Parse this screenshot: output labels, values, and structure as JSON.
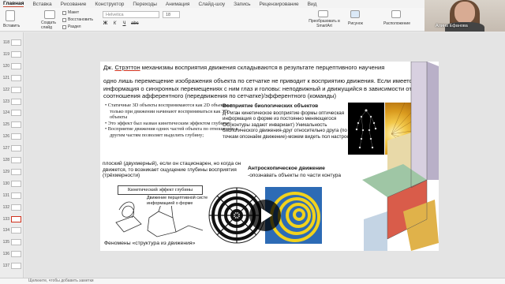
{
  "ribbon": {
    "tabs": [
      "Главная",
      "Вставка",
      "Рисование",
      "Конструктор",
      "Переходы",
      "Анимация",
      "Слайд-шоу",
      "Запись",
      "Рецензирование",
      "Вид"
    ],
    "active_tab": "Главная",
    "paste_label": "Вставить",
    "new_slide_label": "Создать слайд",
    "layout_label": "Макет",
    "reset_label": "Восстановить",
    "section_label": "Раздел",
    "font_placeholder": "Helvetica",
    "font_size": "18",
    "smartart_label": "Преобразовать в SmartArt",
    "picture_label": "Рисунок",
    "arrange_label": "Расположение"
  },
  "webcam": {
    "name": "Алина Ефанова"
  },
  "slide_panel": {
    "numbers": [
      "118",
      "119",
      "120",
      "121",
      "122",
      "123",
      "124",
      "125",
      "126",
      "127",
      "128",
      "129",
      "130",
      "131",
      "132",
      "133",
      "134",
      "135",
      "136",
      "137"
    ],
    "selected": "133"
  },
  "slide": {
    "title_pre": "Дж. ",
    "title_name": "Стрэттон",
    "title_post": " механизмы восприятия движения складываются в результате перцептивного научения",
    "intro": "одно лишь перемещение изображения объекта по сетчатке не приводит к восприятию движения. Если имеется информация о синхронных перемещениях с ним глаз и головы: неподвижный и движущийся в зависимости от соотношения афферентного (передвижения по сетчатке)/эфферентного (команды)",
    "bullets": [
      "Статичные 3D объекты воспринимаются как 2D объекты и только при движении начинают восприниматься как 3D объекты",
      "Это эффект был назван кинетическим эффектом глубины;",
      "Восприятие движения одних частей объекта по отношению к другим частям позволяет выделить глубину;"
    ],
    "flat_text": "плоский (двухмерный), если он стационарен, но когда он движется, то возникает ощущение глубины восприятия (трёхмерности)",
    "bio_heading": "Восприятие биологических объектов",
    "bio_text": "Д Риган кинетическое восприятие формы оптическая информация о форме из постоянно меняющегося ОС(контуры задают инвариант) Уникальность биологического движения-друг относительно друга (по 12 точкам опознаём движение)-можем видеть пол настроение",
    "antro_heading": "Антроскопическое движение",
    "antro_text": "-опознавать объекты по части контура",
    "kinetic_label": "Кинетический эффект глубины",
    "movement_caption": "Движение перцептивной систе информацией о форме",
    "phenomena": "Феномены «структура из движения»"
  },
  "notes": {
    "placeholder": "Щелкните, чтобы добавить заметки"
  },
  "colors": {
    "accent": "#d0321e",
    "spiral_yellow": "#f2d21c",
    "spiral_blue": "#2d6bb5"
  }
}
